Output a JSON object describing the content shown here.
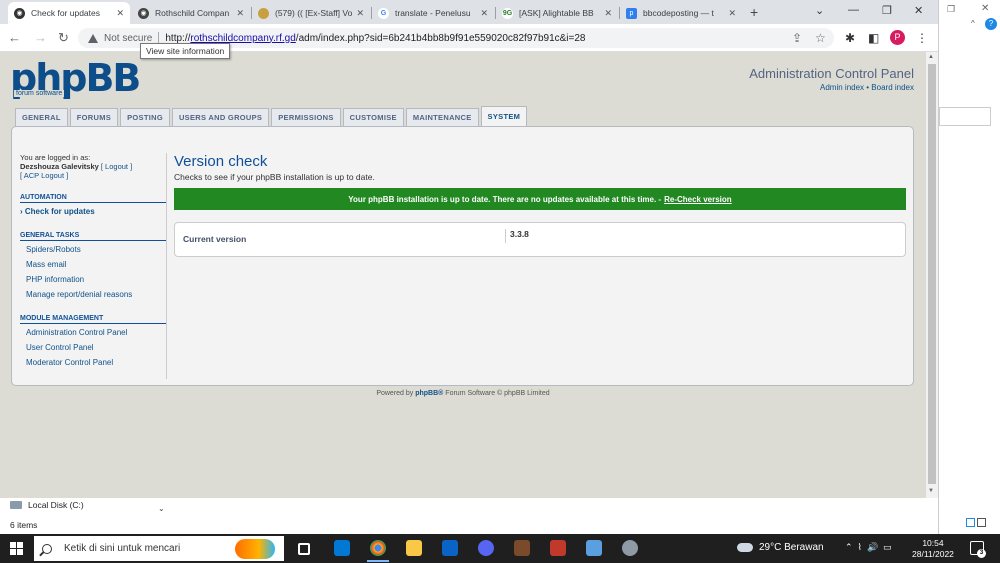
{
  "browser": {
    "tabs": [
      {
        "title": "Check for updates",
        "active": true
      },
      {
        "title": "Rothschild Compan"
      },
      {
        "title": "(579) (( [Ex-Staff] Vo"
      },
      {
        "title": "translate - Penelusu"
      },
      {
        "title": "[ASK] Alightable BB"
      },
      {
        "title": "bbcodeposting — t"
      }
    ],
    "not_secure": "Not secure",
    "url_scheme": "http://",
    "url_host": "rothschildcompany.rf.gd",
    "url_path": "/adm/index.php?sid=6b241b4bb8b9f91e559020c82f97b91c&i=28",
    "tooltip": "View site information",
    "profile_initial": "P"
  },
  "header": {
    "logo": "phpBB",
    "logo_sub": "forum software",
    "acp_title": "Administration Control Panel",
    "admin_index": "Admin index",
    "link_sep": " • ",
    "board_index": "Board index"
  },
  "tabs": [
    "GENERAL",
    "FORUMS",
    "POSTING",
    "USERS AND GROUPS",
    "PERMISSIONS",
    "CUSTOMISE",
    "MAINTENANCE",
    "SYSTEM"
  ],
  "menu": {
    "logged_in_as": "You are logged in as:",
    "username": "Dezshouza Galevitsky",
    "logout": "[ Logout ]",
    "acp_logout": "[ ACP Logout ]",
    "section_automation": "AUTOMATION",
    "check_updates": "Check for updates",
    "section_general": "GENERAL TASKS",
    "general_items": [
      "Spiders/Robots",
      "Mass email",
      "PHP information",
      "Manage report/denial reasons"
    ],
    "section_module": "MODULE MANAGEMENT",
    "module_items": [
      "Administration Control Panel",
      "User Control Panel",
      "Moderator Control Panel"
    ]
  },
  "main": {
    "title": "Version check",
    "description": "Checks to see if your phpBB installation is up to date.",
    "success_text": "Your phpBB installation is up to date. There are no updates available at this time. -",
    "recheck": "Re-Check version",
    "current_version_label": "Current version",
    "current_version_value": "3.3.8"
  },
  "footer": {
    "powered_by": "Powered by",
    "phpbb": "phpBB®",
    "rest": "Forum Software © phpBB Limited"
  },
  "explorer": {
    "disk": "Local Disk (C:)",
    "items": "6 items"
  },
  "taskbar": {
    "search_placeholder": "Ketik di sini untuk mencari",
    "weather": "29°C  Berawan",
    "time": "10:54",
    "date": "28/11/2022",
    "notifications": "3"
  },
  "colors": {
    "brand": "#0c4d8a",
    "success": "#228822",
    "link": "#105289"
  }
}
